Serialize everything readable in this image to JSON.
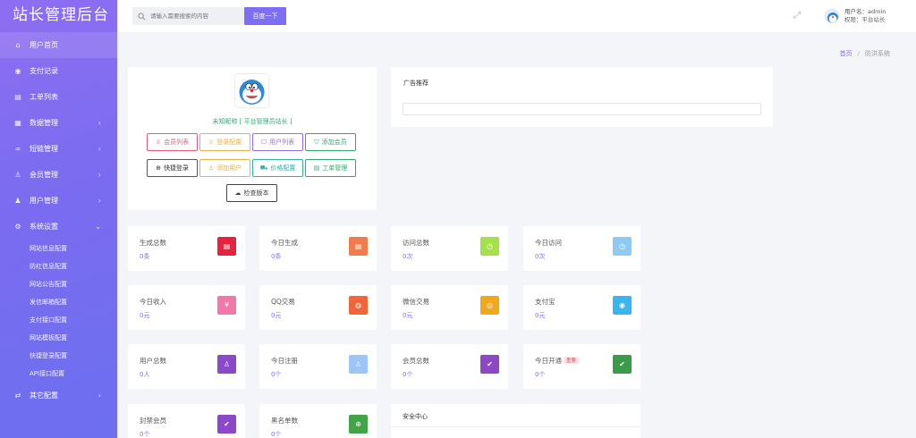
{
  "app": {
    "title": "站长管理后台"
  },
  "sidebar": {
    "items": [
      {
        "label": "用户首页",
        "icon": "home-icon",
        "glyph": "⌂",
        "chevron": ""
      },
      {
        "label": "支付记录",
        "icon": "payment-icon",
        "glyph": "◉",
        "chevron": ""
      },
      {
        "label": "工单列表",
        "icon": "ticket-icon",
        "glyph": "▤",
        "chevron": ""
      },
      {
        "label": "数据管理",
        "icon": "calendar-icon",
        "glyph": "▦",
        "chevron": "›"
      },
      {
        "label": "短链管理",
        "icon": "link-icon",
        "glyph": "∞",
        "chevron": "›"
      },
      {
        "label": "会员管理",
        "icon": "member-icon",
        "glyph": "♙",
        "chevron": "›"
      },
      {
        "label": "用户管理",
        "icon": "user-icon",
        "glyph": "♟",
        "chevron": "›"
      },
      {
        "label": "系统设置",
        "icon": "gear-icon",
        "glyph": "⚙",
        "chevron": "⌄"
      }
    ],
    "sub_items": [
      "网站信息配置",
      "防红信息配置",
      "网站公告配置",
      "发信邮箱配置",
      "支付接口配置",
      "网站模板配置",
      "快捷登录配置",
      "API接口配置"
    ],
    "other": {
      "label": "其它配置",
      "icon": "other-icon",
      "glyph": "⇄",
      "chevron": "›"
    }
  },
  "header": {
    "search_placeholder": "请输入需要搜索的内容",
    "search_button": "百度一下",
    "user_name": "用户名：admin",
    "user_role": "权限：平台站长"
  },
  "breadcrumb": {
    "home": "首页",
    "current": "防洪系统"
  },
  "profile": {
    "nickname": "未知昵称 [ 平台管理员站长 ]",
    "buttons": [
      {
        "label": "会员列表",
        "glyph": "♕",
        "color": "#e85c7a"
      },
      {
        "label": "登录配置",
        "glyph": "♕",
        "color": "#e8b04a"
      },
      {
        "label": "用户列表",
        "glyph": "☐",
        "color": "#9c6be0"
      },
      {
        "label": "添加会员",
        "glyph": "⛉",
        "color": "#33a86e"
      },
      {
        "label": "快捷登录",
        "glyph": "⊕",
        "color": "#444444"
      },
      {
        "label": "添加用户",
        "glyph": "♙",
        "color": "#e8b04a"
      },
      {
        "label": "价格配置",
        "glyph": "⛟",
        "color": "#33b0a4"
      },
      {
        "label": "工单管理",
        "glyph": "▤",
        "color": "#33a86e"
      },
      {
        "label": "检查版本",
        "glyph": "☁",
        "color": "#444444"
      }
    ]
  },
  "ad": {
    "title": "广告推荐"
  },
  "stats": [
    {
      "label": "生成总数",
      "value": "0条",
      "color": "#e8213c",
      "glyph": "▤",
      "icon": "document-icon",
      "tag": ""
    },
    {
      "label": "今日生成",
      "value": "0条",
      "color": "#f07c4d",
      "glyph": "▤",
      "icon": "edit-document-icon",
      "tag": ""
    },
    {
      "label": "访问总数",
      "value": "0次",
      "color": "#a4e048",
      "glyph": "◷",
      "icon": "clock-icon",
      "tag": ""
    },
    {
      "label": "今日访问",
      "value": "0次",
      "color": "#8fc9f4",
      "glyph": "◷",
      "icon": "clock-icon",
      "tag": ""
    },
    {
      "label": "今日收入",
      "value": "0元",
      "color": "#f079aa",
      "glyph": "¥",
      "icon": "yuan-icon",
      "tag": ""
    },
    {
      "label": "QQ交易",
      "value": "0元",
      "color": "#f0663a",
      "glyph": "◍",
      "icon": "qq-icon",
      "tag": ""
    },
    {
      "label": "微信交易",
      "value": "0元",
      "color": "#f2a81d",
      "glyph": "◎",
      "icon": "wechat-icon",
      "tag": ""
    },
    {
      "label": "支付宝",
      "value": "0元",
      "color": "#38b6f0",
      "glyph": "◉",
      "icon": "alipay-icon",
      "tag": ""
    },
    {
      "label": "用户总数",
      "value": "0人",
      "color": "#8b49c9",
      "glyph": "♙",
      "icon": "user-icon",
      "tag": ""
    },
    {
      "label": "今日注册",
      "value": "0个",
      "color": "#9cc6f7",
      "glyph": "♙",
      "icon": "user-add-icon",
      "tag": ""
    },
    {
      "label": "会员总数",
      "value": "0个",
      "color": "#8d47c7",
      "glyph": "✔",
      "icon": "shield-icon",
      "tag": ""
    },
    {
      "label": "今日开通",
      "value": "0个",
      "color": "#3c9b4a",
      "glyph": "✔",
      "icon": "shield-icon",
      "tag": "重要"
    },
    {
      "label": "封禁会员",
      "value": "0个",
      "color": "#8b49c9",
      "glyph": "✔",
      "icon": "shield-icon",
      "tag": ""
    },
    {
      "label": "黑名单数",
      "value": "0个",
      "color": "#43a347",
      "glyph": "⊕",
      "icon": "globe-icon",
      "tag": ""
    }
  ],
  "security": {
    "title": "安全中心"
  }
}
